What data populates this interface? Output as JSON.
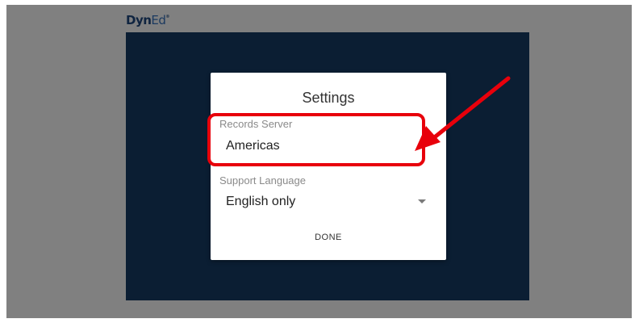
{
  "brand": {
    "logo_main": "Dyn",
    "logo_accent": "Ed",
    "logo_mark": "®"
  },
  "dialog": {
    "title": "Settings",
    "records_server": {
      "label": "Records Server",
      "value": "Americas"
    },
    "support_language": {
      "label": "Support Language",
      "value": "English only"
    },
    "done_label": "DONE"
  },
  "annotation": {
    "color": "#e8000b"
  },
  "colors": {
    "background_gray": "#808080",
    "app_panel": "#0b1e33",
    "dialog": "#ffffff"
  }
}
